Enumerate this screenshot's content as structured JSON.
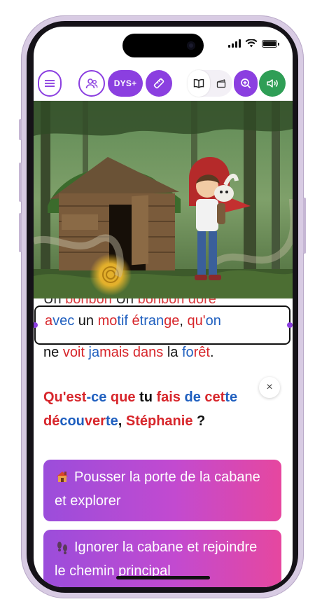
{
  "status_bar": {
    "icons": [
      "signal-icon",
      "wifi-icon",
      "battery-icon"
    ]
  },
  "toolbar": {
    "menu_icon": "hamburger-menu-icon",
    "profile_icon": "users-icon",
    "dys_label": "DYS+",
    "ruler_icon": "ruler-icon",
    "book_icon": "book-open-icon",
    "clapper_icon": "clapperboard-icon",
    "zoom_icon": "zoom-in-icon",
    "sound_icon": "speaker-icon",
    "accent": "#8b3fe0",
    "green": "#2f9e56"
  },
  "scene": {
    "description": "illustration"
  },
  "reader": {
    "partial_line": [
      {
        "t": "Un",
        "c": "k"
      },
      {
        "t": " ",
        "c": "k"
      },
      {
        "t": "bonbon",
        "c": "r"
      },
      {
        "t": " ",
        "c": "k"
      },
      {
        "t": "Un",
        "c": "k"
      },
      {
        "t": " ",
        "c": "k"
      },
      {
        "t": "bonbon dore",
        "c": "r"
      }
    ],
    "focus_line": [
      {
        "t": "a",
        "c": "r"
      },
      {
        "t": "vec",
        "c": "b"
      },
      {
        "t": " un ",
        "c": "k"
      },
      {
        "t": "mo",
        "c": "r"
      },
      {
        "t": "tif ",
        "c": "b"
      },
      {
        "t": "é",
        "c": "r"
      },
      {
        "t": "tran",
        "c": "b"
      },
      {
        "t": "ge",
        "c": "r"
      },
      {
        "t": ", ",
        "c": "k"
      },
      {
        "t": "qu'",
        "c": "r"
      },
      {
        "t": "on",
        "c": "b"
      }
    ],
    "after_line": [
      {
        "t": "ne ",
        "c": "k"
      },
      {
        "t": "voit ",
        "c": "r"
      },
      {
        "t": "ja",
        "c": "b"
      },
      {
        "t": "mais ",
        "c": "r"
      },
      {
        "t": "dans ",
        "c": "r"
      },
      {
        "t": "la ",
        "c": "k"
      },
      {
        "t": "fo",
        "c": "b"
      },
      {
        "t": "rêt",
        "c": "r"
      },
      {
        "t": ".",
        "c": "k"
      }
    ],
    "question_line1": [
      {
        "t": "Qu'est",
        "c": "r"
      },
      {
        "t": "-ce ",
        "c": "b"
      },
      {
        "t": "que ",
        "c": "r"
      },
      {
        "t": "tu ",
        "c": "k"
      },
      {
        "t": "fais ",
        "c": "r"
      },
      {
        "t": "de ",
        "c": "b"
      },
      {
        "t": "cet",
        "c": "r"
      },
      {
        "t": "te",
        "c": "b"
      }
    ],
    "question_line2": [
      {
        "t": "dé",
        "c": "r"
      },
      {
        "t": "cou",
        "c": "b"
      },
      {
        "t": "ver",
        "c": "r"
      },
      {
        "t": "te",
        "c": "b"
      },
      {
        "t": ", ",
        "c": "k"
      },
      {
        "t": "Stéphanie",
        "c": "r"
      },
      {
        "t": " ?",
        "c": "k"
      }
    ],
    "close_label": "×"
  },
  "choices": [
    {
      "label": "Pousser la porte de la cabane et explorer",
      "icon": "house-icon"
    },
    {
      "label": "Ignorer la cabane et rejoindre le chemin principal",
      "icon": "footprints-icon"
    }
  ]
}
